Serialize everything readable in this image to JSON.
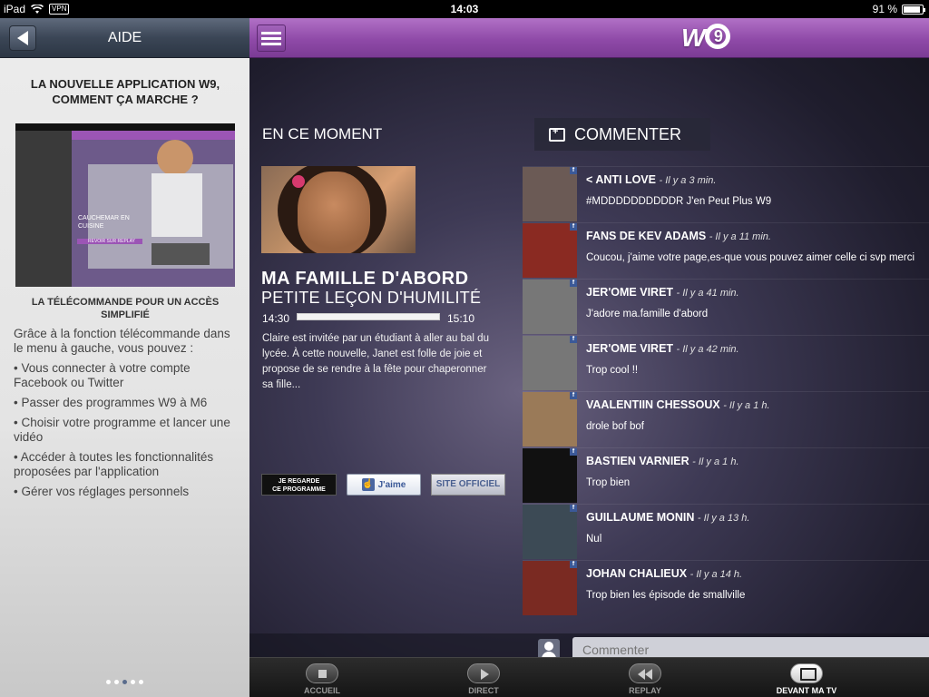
{
  "status_bar": {
    "device": "iPad",
    "vpn": "VPN",
    "time": "14:03",
    "battery": "91 %",
    "battery_level": 0.91
  },
  "help_panel": {
    "title": "AIDE",
    "heading": "LA NOUVELLE APPLICATION W9, COMMENT ÇA MARCHE ?",
    "screenshot_caption": "CAUCHEMAR EN CUISINE",
    "screenshot_button": "REVOIR SUR REPLAY",
    "subheading": "LA TÉLÉCOMMANDE POUR UN ACCÈS SIMPLIFIÉ",
    "intro": "Grâce à la fonction télécommande dans le menu à gauche, vous pouvez :",
    "items": [
      "• Vous connecter à votre compte Facebook ou Twitter",
      "• Passer des programmes W9 à M6",
      "• Choisir votre programme et lancer une vidéo",
      "• Accéder à toutes les fonctionnalités proposées par l'application",
      "• Gérer vos réglages personnels"
    ],
    "page_count": 5,
    "page_active": 2
  },
  "header": {
    "logo_letter": "W",
    "logo_number": "9",
    "brand_color": "#9b55b5"
  },
  "now_playing": {
    "label": "EN CE MOMENT",
    "show_title": "MA FAMILLE D'ABORD",
    "episode_title": "PETITE LEÇON D'HUMILITÉ",
    "start_time": "14:30",
    "end_time": "15:10",
    "progress": 1.0,
    "synopsis": "Claire est invitée par un étudiant à aller au bal du lycée. À cette nouvelle, Janet est folle de joie et propose de se rendre à la fête pour chaperonner sa fille...",
    "btn_watch_line1": "JE REGARDE",
    "btn_watch_line2": "CE PROGRAMME",
    "btn_like": "J'aime",
    "btn_site": "SITE OFFICIEL"
  },
  "comments": {
    "tab_label": "COMMENTER",
    "input_placeholder": "Commenter",
    "items": [
      {
        "name": "ANTI LOVE",
        "prefix": "< ",
        "time": "- Il y a 3 min.",
        "text": "#MDDDDDDDDDDR J'en Peut Plus W9",
        "avatar_color": "#6b5a55"
      },
      {
        "name": "FANS DE KEV ADAMS",
        "prefix": "",
        "time": "- Il y a 11 min.",
        "text": "Coucou, j'aime votre page,es-que vous pouvez aimer celle ci svp merci",
        "avatar_color": "#8a2a22"
      },
      {
        "name": "JER'OME VIRET",
        "prefix": "",
        "time": "- Il y a 41 min.",
        "text": "J'adore ma.famille d'abord",
        "avatar_color": "#777777"
      },
      {
        "name": "JER'OME VIRET",
        "prefix": "",
        "time": "- Il y a 42 min.",
        "text": "Trop cool !!",
        "avatar_color": "#777777"
      },
      {
        "name": "VAALENTIIN CHESSOUX",
        "prefix": "",
        "time": "- Il y a 1 h.",
        "text": "drole bof bof",
        "avatar_color": "#9a7a58"
      },
      {
        "name": "BASTIEN VARNIER",
        "prefix": "",
        "time": "- Il y a 1 h.",
        "text": "Trop bien",
        "avatar_color": "#111111"
      },
      {
        "name": "GUILLAUME MONIN",
        "prefix": "",
        "time": "- Il y a 13 h.",
        "text": "Nul",
        "avatar_color": "#3c4a55"
      },
      {
        "name": "JOHAN CHALIEUX",
        "prefix": "",
        "time": "- Il y a 14 h.",
        "text": "Trop bien les épisode de smallville",
        "avatar_color": "#7a2a22"
      }
    ]
  },
  "tabbar": {
    "items": [
      {
        "label": "ACCUEIL",
        "icon": "stop-icon",
        "active": false
      },
      {
        "label": "DIRECT",
        "icon": "play-icon",
        "active": false
      },
      {
        "label": "REPLAY",
        "icon": "rewind-icon",
        "active": false
      },
      {
        "label": "DEVANT MA TV",
        "icon": "tv-icon",
        "active": true
      }
    ]
  }
}
